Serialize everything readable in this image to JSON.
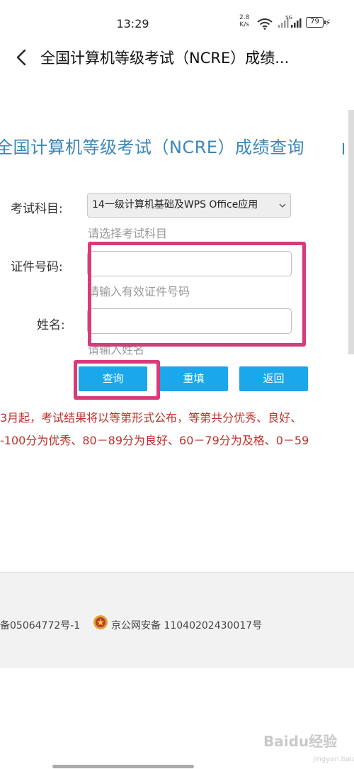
{
  "status_bar": {
    "time": "13:29",
    "speed_value": "2.8",
    "speed_unit": "K/s",
    "network": "5G",
    "battery": "79"
  },
  "title_bar": {
    "title": "全国计算机等级考试（NCRE）成绩..."
  },
  "header": {
    "title": "全国计算机等级考试（NCRE）成绩查询"
  },
  "form": {
    "subject_label": "考试科目:",
    "subject_value": "14一级计算机基础及WPS Office应用",
    "subject_hint": "请选择考试科目",
    "id_label": "证件号码:",
    "id_value": "",
    "id_hint": "请输入有效证件号码",
    "name_label": "姓名:",
    "name_value": "",
    "name_hint": "请输入姓名"
  },
  "buttons": {
    "query": "查询",
    "reset": "重填",
    "back": "返回"
  },
  "notice": {
    "line1": "3月起，考试结果将以等第形式公布，等第共分优秀、良好、",
    "line2": "-100分为优秀、80－89分为良好、60－79分为及格、0－59"
  },
  "footer": {
    "icp": "备05064772号-1",
    "police": "京公网安备 11040202430017号"
  },
  "watermark": {
    "text": "Baidu经验",
    "sub": "jingyan.baidu.com"
  },
  "colors": {
    "accent": "#1aa8ea",
    "header_text": "#3a86b8",
    "highlight": "#d83b7a",
    "notice": "#c0302a"
  }
}
